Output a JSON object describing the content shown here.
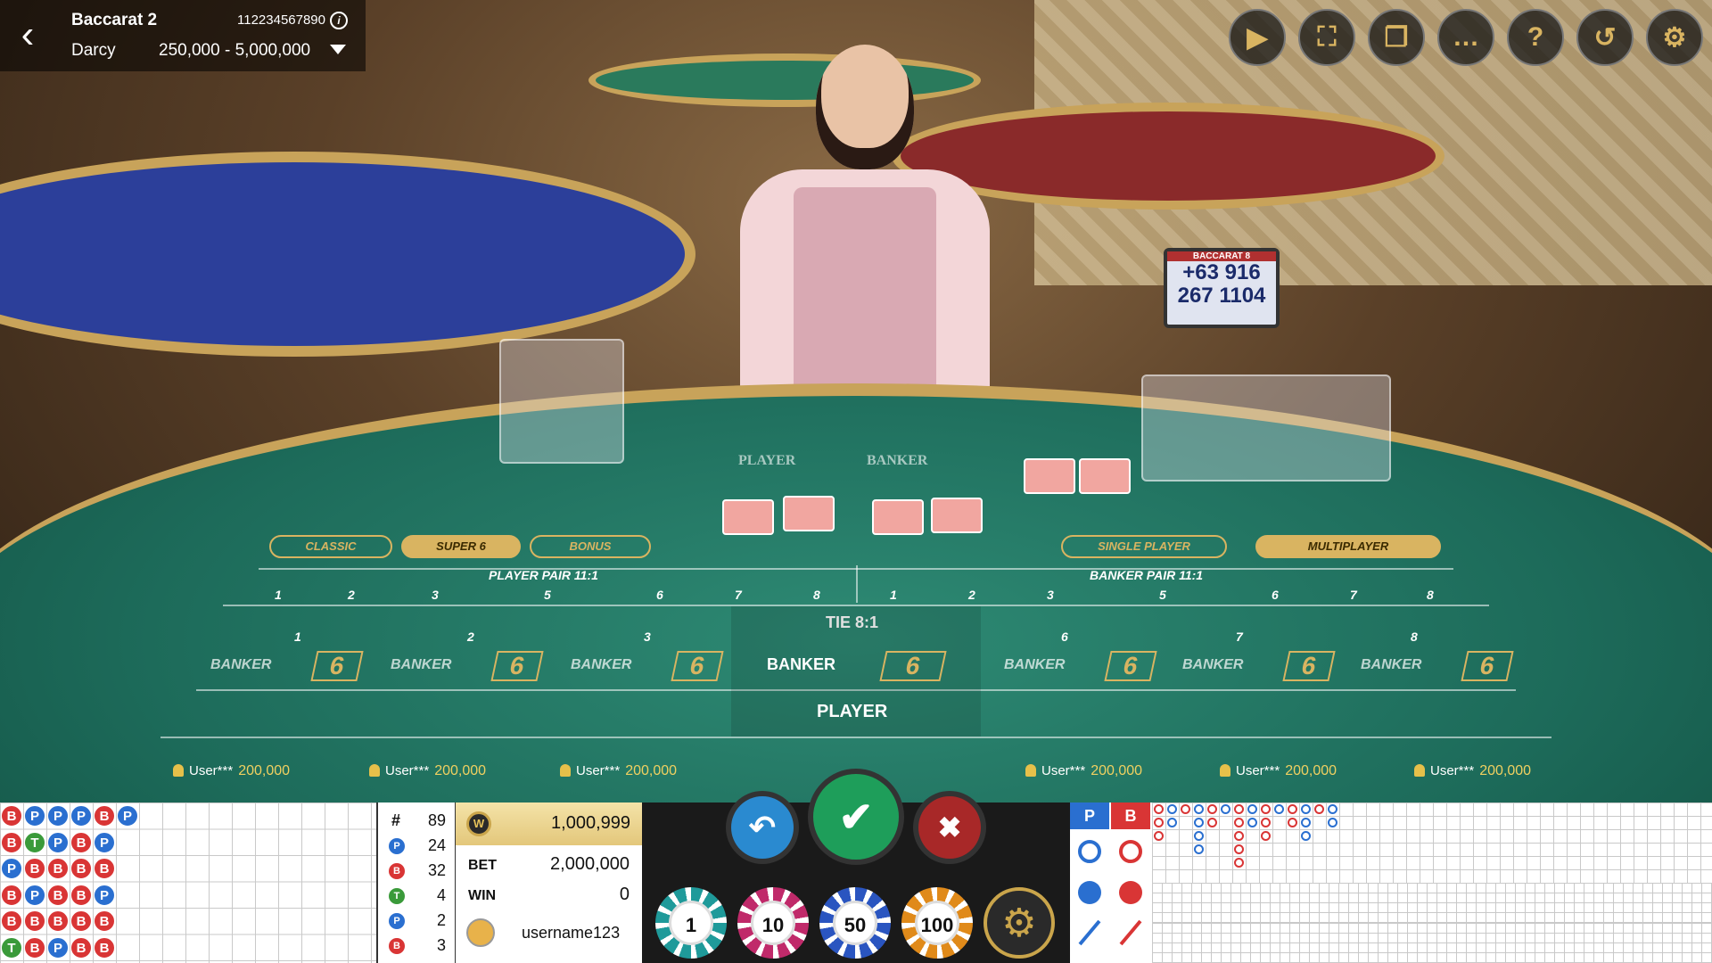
{
  "header": {
    "back_icon": "chevron-left-icon",
    "table_name": "Baccarat 2",
    "table_id": "112234567890",
    "dealer_name": "Darcy",
    "bet_limit": "250,000 - 5,000,000"
  },
  "top_icons": [
    "video-icon",
    "fullscreen-icon",
    "multi-window-icon",
    "chat-icon",
    "help-icon",
    "history-icon",
    "settings-icon"
  ],
  "top_icon_glyphs": [
    "▶",
    "⛶",
    "❐",
    "…",
    "?",
    "↺",
    "⚙"
  ],
  "dealer_sign": {
    "line1": "BACCARAT 8",
    "line2": "+63 916",
    "line3": "267 1104"
  },
  "table_labels": {
    "player": "PLAYER",
    "banker": "BANKER"
  },
  "modes": {
    "classic": "CLASSIC",
    "super6": "SUPER 6",
    "bonus": "BONUS",
    "single": "SINGLE PLAYER",
    "multi": "MULTIPLAYER"
  },
  "pairs": {
    "player_pair": "PLAYER PAIR 11:1",
    "banker_pair": "BANKER PAIR 11:1",
    "numbers": [
      "1",
      "2",
      "3",
      "5",
      "6",
      "7",
      "8",
      "1",
      "2",
      "3",
      "5",
      "6",
      "7",
      "8"
    ]
  },
  "tie": "TIE 8:1",
  "zone_numbers": [
    "1",
    "2",
    "3",
    "6",
    "7",
    "8"
  ],
  "zones": {
    "banker_label": "BANKER",
    "player_label": "PLAYER",
    "six": "6",
    "main_banker": "BANKER",
    "main_player": "PLAYER"
  },
  "seats": [
    {
      "user": "User***",
      "amount": "200,000"
    },
    {
      "user": "User***",
      "amount": "200,000"
    },
    {
      "user": "User***",
      "amount": "200,000"
    },
    {
      "user": "User***",
      "amount": "200,000"
    },
    {
      "user": "User***",
      "amount": "200,000"
    },
    {
      "user": "User***",
      "amount": "200,000"
    }
  ],
  "bead_road": [
    [
      "B",
      "P",
      "P",
      "P",
      "B",
      "P"
    ],
    [
      "B",
      "T",
      "P",
      "B",
      "P"
    ],
    [
      "P",
      "B",
      "B",
      "B",
      "B"
    ],
    [
      "B",
      "P",
      "B",
      "B",
      "P"
    ],
    [
      "B",
      "B",
      "B",
      "B",
      "B"
    ],
    [
      "T",
      "B",
      "P",
      "B",
      "B"
    ]
  ],
  "stats": {
    "hash": "#",
    "total": "89",
    "p": "24",
    "b": "32",
    "t": "4",
    "pp": "2",
    "bp": "3",
    "labels": {
      "p": "P",
      "b": "B",
      "t": "T",
      "pp": "P",
      "bp": "B"
    }
  },
  "wallet": {
    "balance": "1,000,999",
    "bet_label": "BET",
    "bet": "2,000,000",
    "win_label": "WIN",
    "win": "0",
    "username": "username123",
    "coin_symbol": "W"
  },
  "actions": {
    "undo": "↶",
    "confirm": "✔",
    "cancel": "✖"
  },
  "chips": [
    "1",
    "10",
    "50",
    "100"
  ],
  "road_headers": {
    "p": "P",
    "b": "B"
  },
  "colors": {
    "banker": "#d93535",
    "player": "#2a6fd0",
    "tie": "#3a9a3a",
    "gold": "#d9b461"
  }
}
